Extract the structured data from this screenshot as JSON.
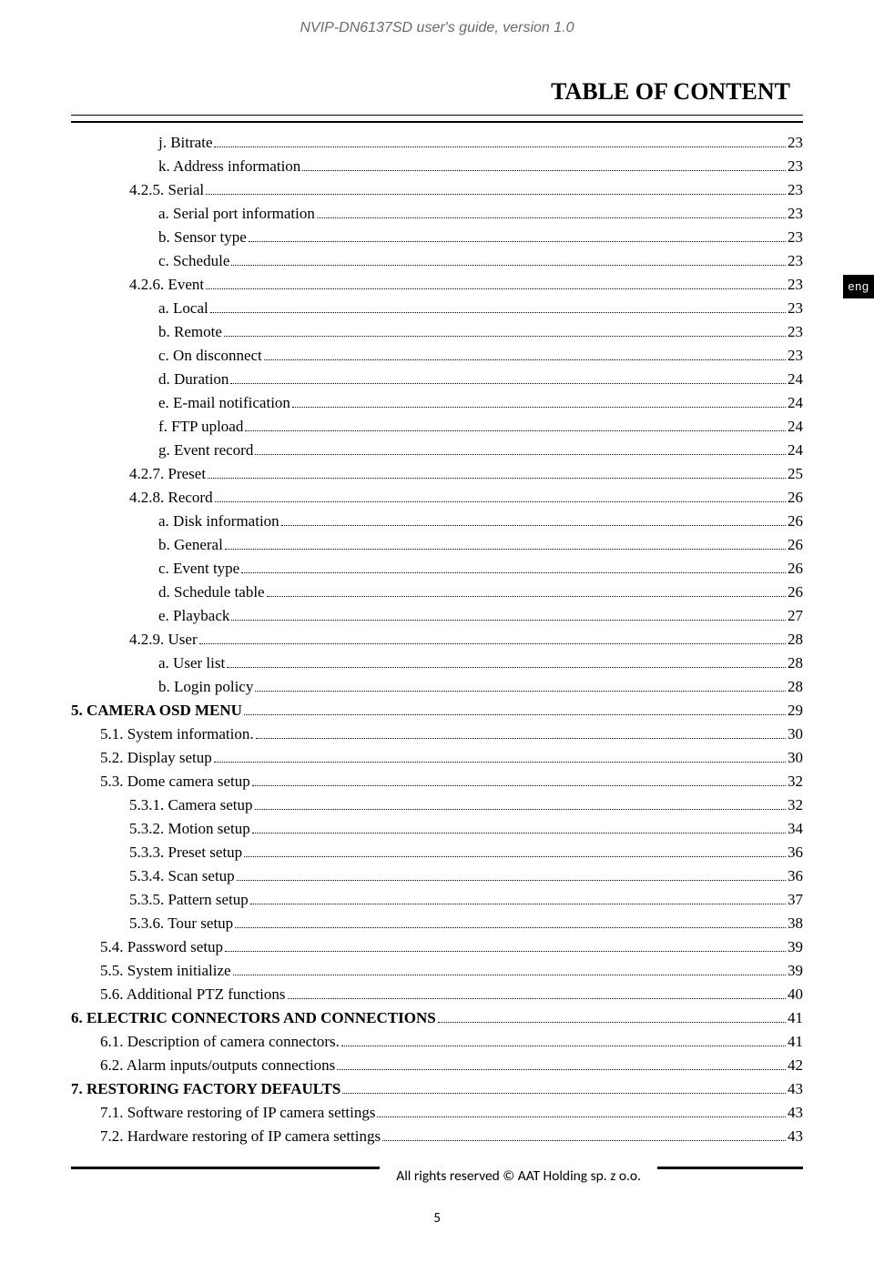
{
  "header": "NVIP-DN6137SD user's guide, version 1.0",
  "title": "TABLE OF CONTENT",
  "lang_tab": "eng",
  "footer": "All rights reserved © AAT Holding sp. z o.o.",
  "page_number": "5",
  "toc": [
    {
      "indent": 3,
      "label": "j. Bitrate",
      "page": "23"
    },
    {
      "indent": 3,
      "label": "k. Address information",
      "page": "23"
    },
    {
      "indent": 2,
      "label": "4.2.5. Serial",
      "page": "23"
    },
    {
      "indent": 3,
      "label": "a. Serial port information",
      "page": "23"
    },
    {
      "indent": 3,
      "label": "b. Sensor type",
      "page": "23"
    },
    {
      "indent": 3,
      "label": "c. Schedule",
      "page": "23"
    },
    {
      "indent": 2,
      "label": "4.2.6. Event",
      "page": "23"
    },
    {
      "indent": 3,
      "label": "a. Local",
      "page": "23"
    },
    {
      "indent": 3,
      "label": "b. Remote",
      "page": "23"
    },
    {
      "indent": 3,
      "label": "c. On disconnect",
      "page": "23"
    },
    {
      "indent": 3,
      "label": "d. Duration",
      "page": "24"
    },
    {
      "indent": 3,
      "label": "e. E-mail notification",
      "page": "24"
    },
    {
      "indent": 3,
      "label": "f. FTP upload",
      "page": "24"
    },
    {
      "indent": 3,
      "label": "g. Event record",
      "page": "24"
    },
    {
      "indent": 2,
      "label": "4.2.7. Preset",
      "page": "25"
    },
    {
      "indent": 2,
      "label": "4.2.8. Record",
      "page": "26"
    },
    {
      "indent": 3,
      "label": "a. Disk information",
      "page": "26"
    },
    {
      "indent": 3,
      "label": "b. General",
      "page": "26"
    },
    {
      "indent": 3,
      "label": "c. Event type ",
      "page": "26"
    },
    {
      "indent": 3,
      "label": "d. Schedule table",
      "page": "26"
    },
    {
      "indent": 3,
      "label": "e. Playback",
      "page": "27"
    },
    {
      "indent": 2,
      "label": "4.2.9. User",
      "page": "28"
    },
    {
      "indent": 3,
      "label": "a. User list",
      "page": "28"
    },
    {
      "indent": 3,
      "label": "b. Login policy",
      "page": "28"
    },
    {
      "indent": 0,
      "label": "5. CAMERA OSD MENU",
      "page": "29",
      "bold": true
    },
    {
      "indent": 1,
      "label": "5.1. System information. ",
      "page": "30"
    },
    {
      "indent": 1,
      "label": "5.2. Display setup",
      "page": "30"
    },
    {
      "indent": 1,
      "label": "5.3. Dome camera setup",
      "page": "32"
    },
    {
      "indent": 2,
      "label": "5.3.1. Camera setup",
      "page": "32"
    },
    {
      "indent": 2,
      "label": "5.3.2. Motion setup",
      "page": "34"
    },
    {
      "indent": 2,
      "label": "5.3.3. Preset setup",
      "page": "36"
    },
    {
      "indent": 2,
      "label": "5.3.4. Scan setup",
      "page": "36"
    },
    {
      "indent": 2,
      "label": "5.3.5. Pattern setup",
      "page": "37"
    },
    {
      "indent": 2,
      "label": "5.3.6. Tour setup",
      "page": "38"
    },
    {
      "indent": 1,
      "label": "5.4. Password setup",
      "page": "39"
    },
    {
      "indent": 1,
      "label": "5.5. System initialize",
      "page": "39"
    },
    {
      "indent": 1,
      "label": "5.6. Additional PTZ functions",
      "page": "40"
    },
    {
      "indent": 0,
      "label": "6. ELECTRIC CONNECTORS AND CONNECTIONS ",
      "page": "41",
      "bold": true
    },
    {
      "indent": 1,
      "label": "6.1. Description of camera connectors. ",
      "page": "41"
    },
    {
      "indent": 1,
      "label": "6.2. Alarm inputs/outputs connections",
      "page": "42"
    },
    {
      "indent": 0,
      "label": "7. RESTORING FACTORY DEFAULTS ",
      "page": "43",
      "bold": true
    },
    {
      "indent": 1,
      "label": "7.1. Software restoring of IP camera settings",
      "page": "43"
    },
    {
      "indent": 1,
      "label": "7.2. Hardware restoring of IP camera settings",
      "page": "43"
    }
  ]
}
